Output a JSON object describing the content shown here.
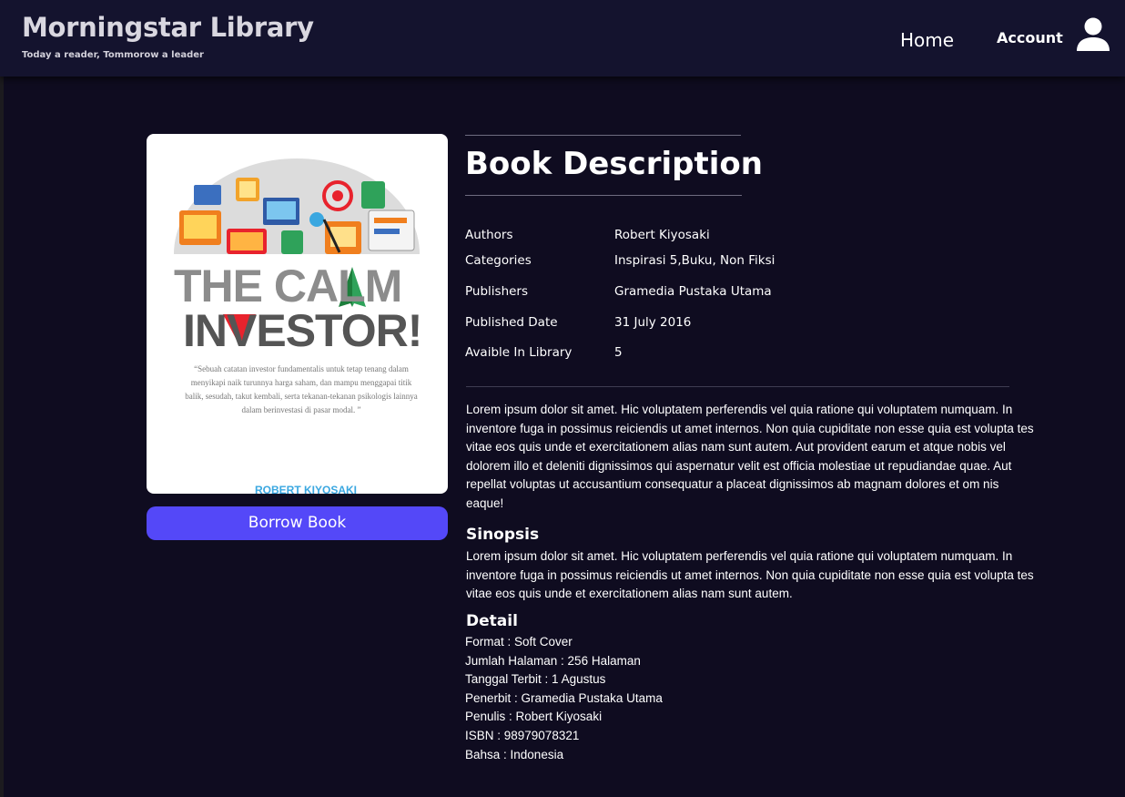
{
  "header": {
    "title": "Morningstar Library",
    "tagline": "Today a reader, Tommorow a leader",
    "nav": {
      "home": "Home",
      "account": "Account"
    }
  },
  "book": {
    "cover": {
      "title_line1": "THE CALM",
      "title_line2": "INVESTOR!",
      "quote": "“Sebuah catatan investor fundamentalis untuk tetap tenang dalam menyikapi naik turunnya harga saham, dan mampu menggapai titik balik, sesudah, takut kembali, serta tekanan-tekanan psikologis lainnya dalam berinvestasi di pasar modal. ”",
      "author_fragment": "ROBERT KIYOSAKI"
    },
    "borrow_label": "Borrow Book",
    "description_title": "Book  Description",
    "meta": [
      {
        "label": "Authors",
        "value": "Robert  Kiyosaki"
      },
      {
        "label": "Categories",
        "value": "Inspirasi 5,Buku, Non Fiksi"
      },
      {
        "label": "Publishers",
        "value": "Gramedia Pustaka Utama"
      },
      {
        "label": "Published Date",
        "value": "31 July 2016"
      },
      {
        "label": "Avaible In Library",
        "value": "5"
      }
    ],
    "description": "Lorem ipsum dolor sit amet. Hic voluptatem perferendis vel quia ratione qui voluptatem numquam. In inventore fuga in possimus reiciendis ut amet internos. Non quia cupiditate non esse quia est volupta tes vitae eos quis unde et exercitationem alias nam sunt autem. Aut provident earum et atque nobis  vel dolorem illo et deleniti dignissimos qui aspernatur velit est officia molestiae ut repudiandae quae. Aut repellat voluptas ut accusantium consequatur a placeat dignissimos ab magnam dolores et om nis eaque!",
    "synopsis_heading": "Sinopsis",
    "synopsis": "Lorem ipsum dolor sit amet. Hic voluptatem perferendis vel quia ratione qui voluptatem numquam. In inventore fuga in possimus reiciendis ut amet internos. Non quia cupiditate non esse quia est volupta tes vitae eos quis unde et exercitationem alias nam sunt autem.",
    "detail_heading": "Detail",
    "details": [
      "Format : Soft  Cover",
      "Jumlah Halaman :  256 Halaman",
      "Tanggal Terbit : 1 Agustus",
      "Penerbit : Gramedia Pustaka Utama",
      "Penulis : Robert Kiyosaki",
      "ISBN : 98979078321",
      "Bahsa : Indonesia"
    ]
  },
  "colors": {
    "background": "#0f0c20",
    "header": "#14132e",
    "accent": "#5448f8",
    "cover_arrow": "#e8232d"
  },
  "icons": {
    "account": "user-icon"
  }
}
